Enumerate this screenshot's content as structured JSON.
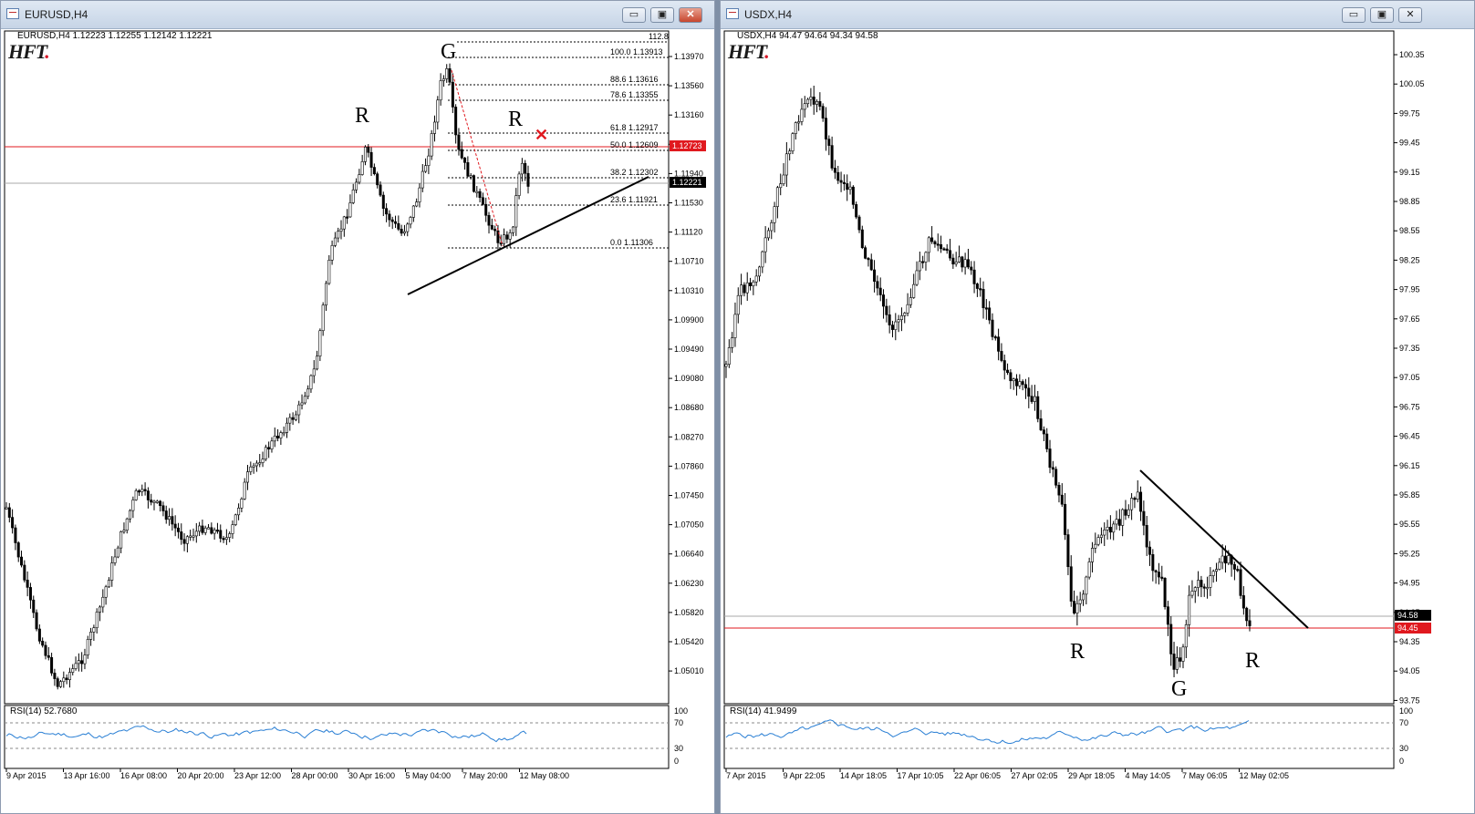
{
  "left": {
    "title": "EURUSD,H4",
    "header": "EURUSD,H4  1.12223 1.12255 1.12142 1.12221",
    "logo": "HFT",
    "price_axis": [
      "1.13970",
      "1.13560",
      "1.13160",
      "1.12340",
      "1.11940",
      "1.11530",
      "1.11120",
      "1.10710",
      "1.10310",
      "1.09900",
      "1.09490",
      "1.09080",
      "1.08680",
      "1.08270",
      "1.07860",
      "1.07450",
      "1.07050",
      "1.06640",
      "1.06230",
      "1.05820",
      "1.05420",
      "1.05010"
    ],
    "fib_top_label": "112.8",
    "fib": [
      {
        "pct": "100.0",
        "price": "1.13913"
      },
      {
        "pct": "88.6",
        "price": "1.13616"
      },
      {
        "pct": "78.6",
        "price": "1.13355"
      },
      {
        "pct": "61.8",
        "price": "1.12917"
      },
      {
        "pct": "50.0",
        "price": "1.12609"
      },
      {
        "pct": "38.2",
        "price": "1.12302"
      },
      {
        "pct": "23.6",
        "price": "1.11921"
      },
      {
        "pct": "0.0",
        "price": "1.11306"
      }
    ],
    "red_level": "1.12723",
    "current_price": "1.12221",
    "pattern_labels": {
      "r1": "R",
      "g": "G",
      "r2": "R"
    },
    "rsi_label": "RSI(14) 52.7680",
    "rsi_axis": [
      "100",
      "70",
      "30",
      "0"
    ],
    "time_axis": [
      "9 Apr 2015",
      "13 Apr 16:00",
      "16 Apr 08:00",
      "20 Apr 20:00",
      "23 Apr 12:00",
      "28 Apr 00:00",
      "30 Apr 16:00",
      "5 May 04:00",
      "7 May 20:00",
      "12 May 08:00"
    ]
  },
  "right": {
    "title": "USDX,H4",
    "header": "USDX,H4  94.47 94.64 94.34 94.58",
    "logo": "HFT",
    "price_axis": [
      "100.35",
      "100.05",
      "99.75",
      "99.45",
      "99.15",
      "98.85",
      "98.55",
      "98.25",
      "97.95",
      "97.65",
      "97.35",
      "97.05",
      "96.75",
      "96.45",
      "96.15",
      "95.85",
      "95.55",
      "95.25",
      "94.95",
      "94.65",
      "94.35",
      "94.05",
      "93.75"
    ],
    "red_level": "94.45",
    "current_price": "94.58",
    "pattern_labels": {
      "r1": "R",
      "g": "G",
      "r2": "R"
    },
    "rsi_label": "RSI(14) 41.9499",
    "rsi_axis": [
      "100",
      "70",
      "30",
      "0"
    ],
    "time_axis": [
      "7 Apr 2015",
      "9 Apr 22:05",
      "14 Apr 18:05",
      "17 Apr 10:05",
      "22 Apr 06:05",
      "27 Apr 02:05",
      "29 Apr 18:05",
      "4 May 14:05",
      "7 May 06:05",
      "12 May 02:05"
    ]
  },
  "window_buttons": {
    "minimize": "▭",
    "maximize": "▣",
    "close": "✕"
  },
  "colors": {
    "candle": "#000000",
    "red_line": "#e0191f",
    "rsi": "#2a7fd4",
    "fib": "#000000",
    "x_mark": "#e0191f"
  }
}
